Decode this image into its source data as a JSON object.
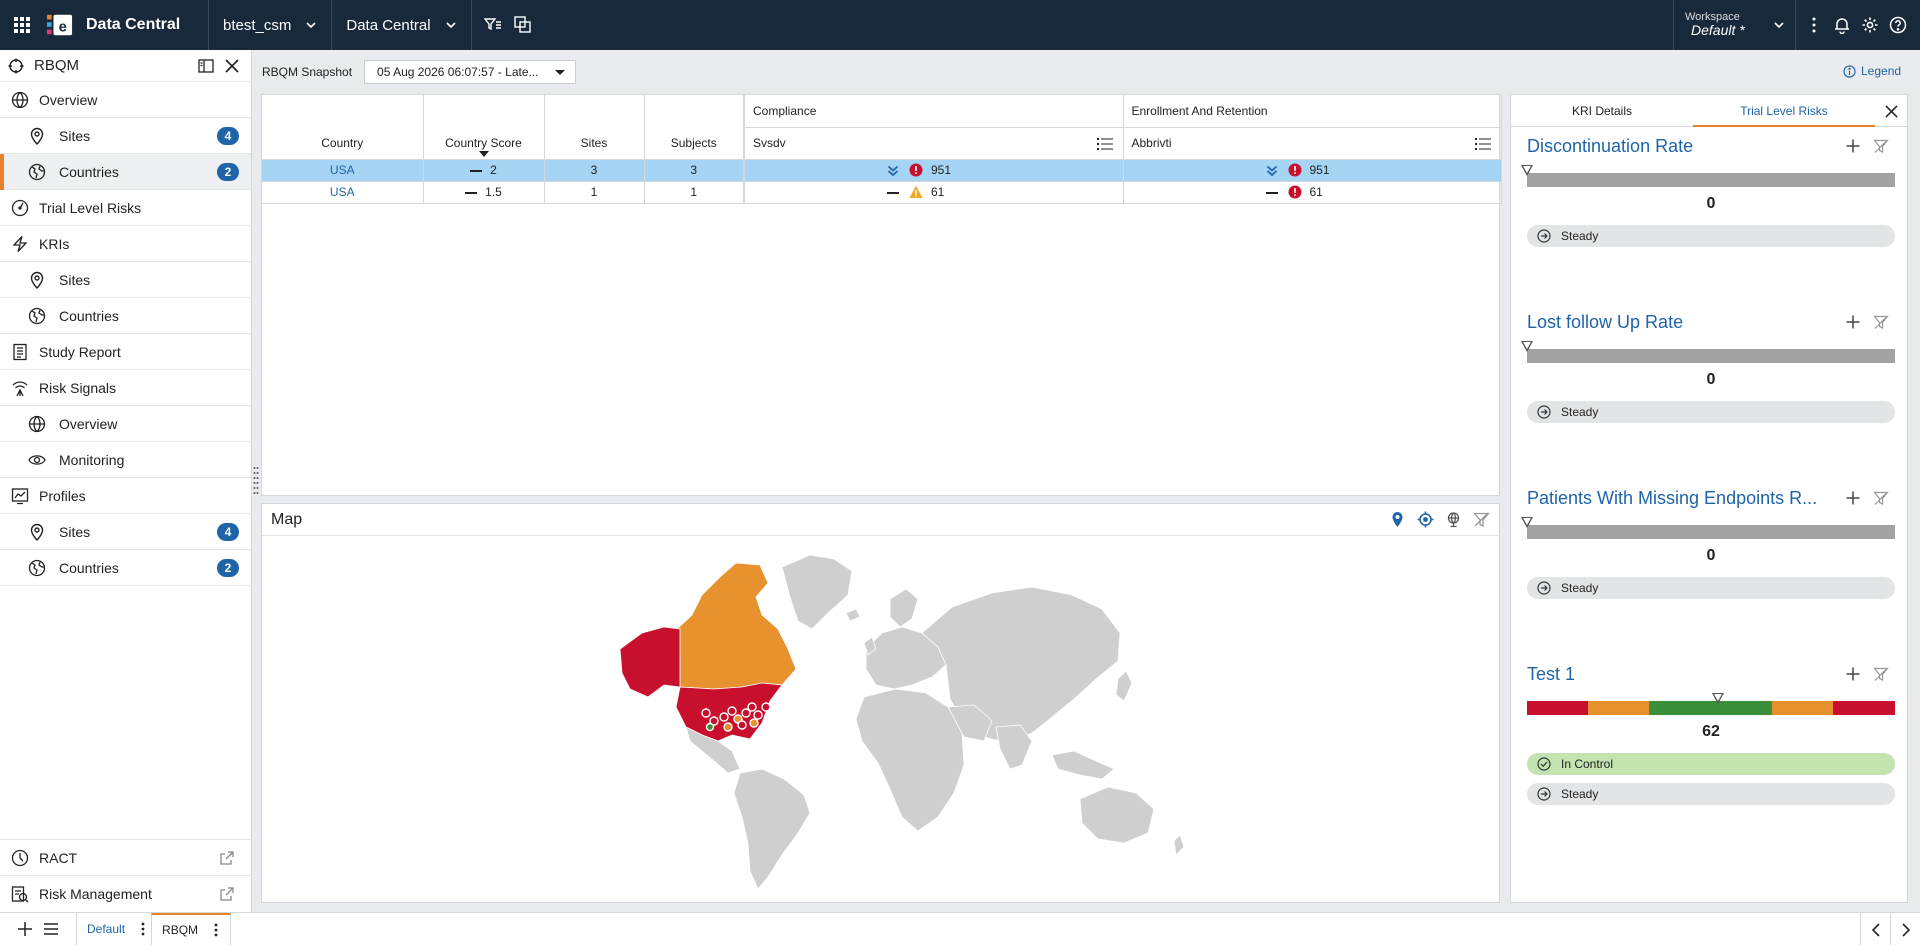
{
  "app": {
    "title": "Data Central",
    "study": "btest_csm",
    "module": "Data Central"
  },
  "workspace": {
    "label": "Workspace",
    "value": "Default *"
  },
  "sidebar": {
    "title": "RBQM",
    "items": [
      {
        "label": "Overview",
        "icon": "globe-icon",
        "level": 0,
        "badge": ""
      },
      {
        "label": "Sites",
        "icon": "location-pin-icon",
        "level": 1,
        "badge": "4"
      },
      {
        "label": "Countries",
        "icon": "countries-globe-icon",
        "level": 1,
        "badge": "2",
        "active": true
      },
      {
        "label": "Trial Level Risks",
        "icon": "gauge-icon",
        "level": 0,
        "badge": ""
      },
      {
        "label": "KRIs",
        "icon": "lightning-icon",
        "level": 0,
        "badge": ""
      },
      {
        "label": "Sites",
        "icon": "location-pin-icon",
        "level": 1,
        "badge": ""
      },
      {
        "label": "Countries",
        "icon": "countries-globe-icon",
        "level": 1,
        "badge": ""
      },
      {
        "label": "Study Report",
        "icon": "report-icon",
        "level": 0,
        "badge": ""
      },
      {
        "label": "Risk Signals",
        "icon": "signal-icon",
        "level": 0,
        "badge": ""
      },
      {
        "label": "Overview",
        "icon": "globe-icon",
        "level": 1,
        "badge": ""
      },
      {
        "label": "Monitoring",
        "icon": "eye-icon",
        "level": 1,
        "badge": ""
      },
      {
        "label": "Profiles",
        "icon": "profile-chart-icon",
        "level": 0,
        "badge": ""
      },
      {
        "label": "Sites",
        "icon": "location-pin-icon",
        "level": 1,
        "badge": "4"
      },
      {
        "label": "Countries",
        "icon": "countries-globe-icon",
        "level": 1,
        "badge": "2"
      }
    ],
    "bottom": [
      {
        "label": "RACT",
        "icon": "ract-icon"
      },
      {
        "label": "Risk Management",
        "icon": "risk-management-icon"
      }
    ]
  },
  "snapshot": {
    "label": "RBQM Snapshot",
    "value": "05 Aug 2026 06:07:57 - Late..."
  },
  "legend": "Legend",
  "table": {
    "columns": {
      "country": "Country",
      "score": "Country Score",
      "sites": "Sites",
      "subjects": "Subjects"
    },
    "groups": [
      {
        "label": "Compliance",
        "sub": "Svsdv"
      },
      {
        "label": "Enrollment And Retention",
        "sub": "Abbrivti"
      }
    ],
    "rows": [
      {
        "country": "USA",
        "score": "2",
        "sites": "3",
        "subjects": "3",
        "k1": "951",
        "k1risk": "red",
        "k1trend": "down",
        "k2": "951",
        "k2risk": "red",
        "k2trend": "down",
        "selected": true
      },
      {
        "country": "USA",
        "score": "1.5",
        "sites": "1",
        "subjects": "1",
        "k1": "61",
        "k1risk": "amber",
        "k1trend": "flat",
        "k2": "61",
        "k2risk": "red",
        "k2trend": "flat",
        "selected": false
      }
    ]
  },
  "map": {
    "title": "Map"
  },
  "right_panel": {
    "tabs": [
      "KRI Details",
      "Trial Level Risks"
    ],
    "active_tab": 1,
    "kris": [
      {
        "title": "Discontinuation Rate",
        "value": "0",
        "status": "",
        "trend": "Steady",
        "marker_fraction": 0
      },
      {
        "title": "Lost follow Up Rate",
        "value": "0",
        "status": "",
        "trend": "Steady",
        "marker_fraction": 0
      },
      {
        "title": "Patients With Missing Endpoints R...",
        "value": "0",
        "status": "",
        "trend": "Steady",
        "marker_fraction": 0
      },
      {
        "title": "Test 1",
        "value": "62",
        "status": "In Control",
        "trend": "Steady",
        "marker_fraction": 0.52
      }
    ]
  },
  "bottom_tabs": [
    "Default",
    "RBQM"
  ],
  "colors": {
    "accent": "#e8832a",
    "primary": "#1f64a8",
    "nav": "#17293b",
    "red": "#c8102e",
    "amber": "#e8912f",
    "green": "#3a8f3a"
  }
}
